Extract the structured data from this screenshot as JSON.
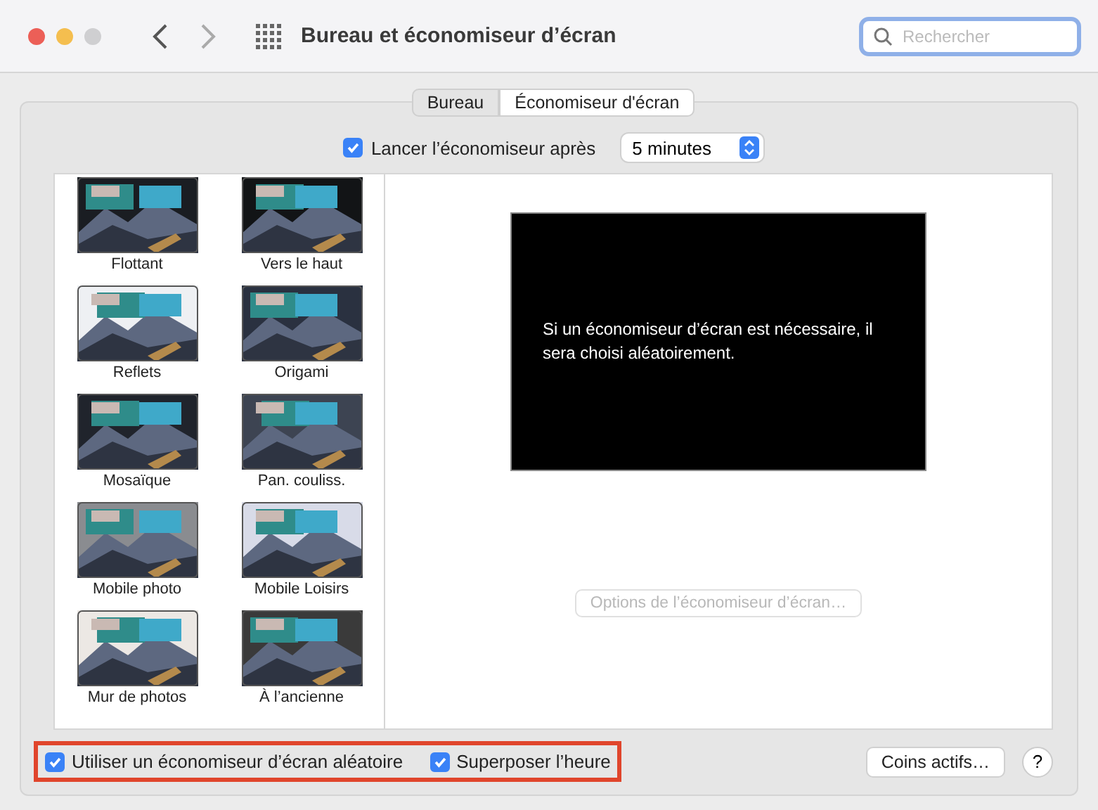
{
  "window": {
    "title": "Bureau et économiseur d’écran"
  },
  "search": {
    "placeholder": "Rechercher"
  },
  "tabs": [
    {
      "label": "Bureau",
      "selected": false
    },
    {
      "label": "Économiseur d'écran",
      "selected": true
    }
  ],
  "start_after": {
    "label": "Lancer l’économiseur après",
    "checked": true,
    "value": "5 minutes"
  },
  "screensavers": [
    {
      "label": "Flottant"
    },
    {
      "label": "Vers le haut"
    },
    {
      "label": "Reflets"
    },
    {
      "label": "Origami"
    },
    {
      "label": "Mosaïque"
    },
    {
      "label": "Pan. couliss."
    },
    {
      "label": "Mobile photo"
    },
    {
      "label": "Mobile Loisirs"
    },
    {
      "label": "Mur de photos"
    },
    {
      "label": "À l’ancienne"
    }
  ],
  "preview": {
    "message": "Si un économiseur d’écran est nécessaire, il sera choisi aléatoirement."
  },
  "options_button": {
    "label": "Options de l’économiseur d’écran…",
    "disabled": true
  },
  "random_option": {
    "label": "Utiliser un économiseur d’écran aléatoire",
    "checked": true
  },
  "clock_option": {
    "label": "Superposer l’heure",
    "checked": true
  },
  "hot_corners_button": {
    "label": "Coins actifs…"
  },
  "help_button": {
    "label": "?"
  }
}
